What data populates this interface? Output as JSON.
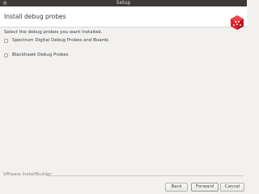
{
  "window": {
    "title": "Setup",
    "close_glyph": "×"
  },
  "header": {
    "title": "Install debug probes",
    "logo_icon": "installbuilder-logo-icon"
  },
  "main": {
    "instruction": "Select the debug probes you want installed.",
    "options": [
      {
        "label": "Spectrum Digital Debug Probes and Boards",
        "checked": false
      },
      {
        "label": "Blackhawk Debug Probes",
        "checked": false
      }
    ]
  },
  "footer": {
    "brand": "VMware InstallBuilder",
    "back_label": "Back",
    "forward_label": "Forward",
    "cancel_label": "Cancel"
  },
  "colors": {
    "logo_red": "#e2202b",
    "titlebar": "#3c3b37"
  }
}
